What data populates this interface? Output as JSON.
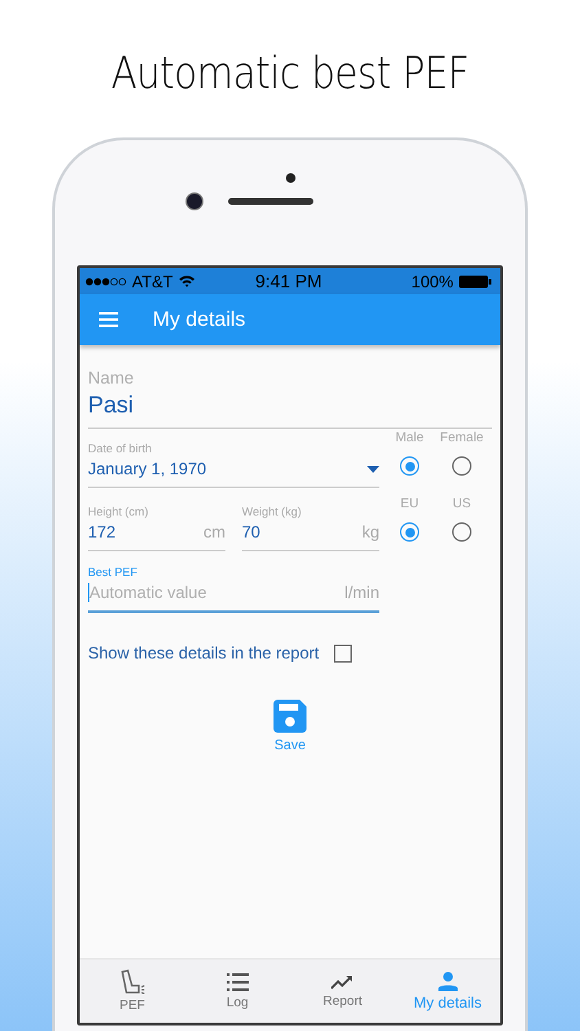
{
  "headline": "Automatic best PEF",
  "status_bar": {
    "carrier": "AT&T",
    "time": "9:41 PM",
    "battery": "100%"
  },
  "app_bar": {
    "title": "My details"
  },
  "name": {
    "label": "Name",
    "value": "Pasi"
  },
  "date_of_birth": {
    "label": "Date of birth",
    "value": "January 1, 1970"
  },
  "height": {
    "label": "Height (cm)",
    "value": "172",
    "unit": "cm"
  },
  "weight": {
    "label": "Weight (kg)",
    "value": "70",
    "unit": "kg"
  },
  "best_pef": {
    "label": "Best PEF",
    "placeholder": "Automatic value",
    "unit": "l/min",
    "focused": true
  },
  "gender": [
    {
      "label": "Male",
      "selected": true
    },
    {
      "label": "Female",
      "selected": false
    }
  ],
  "units": [
    {
      "label": "EU",
      "selected": true
    },
    {
      "label": "US",
      "selected": false
    }
  ],
  "show_in_report": {
    "label": "Show these details in the report",
    "checked": false
  },
  "save_button": {
    "label": "Save"
  },
  "nav": [
    {
      "label": "PEF",
      "selected": false
    },
    {
      "label": "Log",
      "selected": false
    },
    {
      "label": "Report",
      "selected": false
    },
    {
      "label": "My details",
      "selected": true
    }
  ]
}
